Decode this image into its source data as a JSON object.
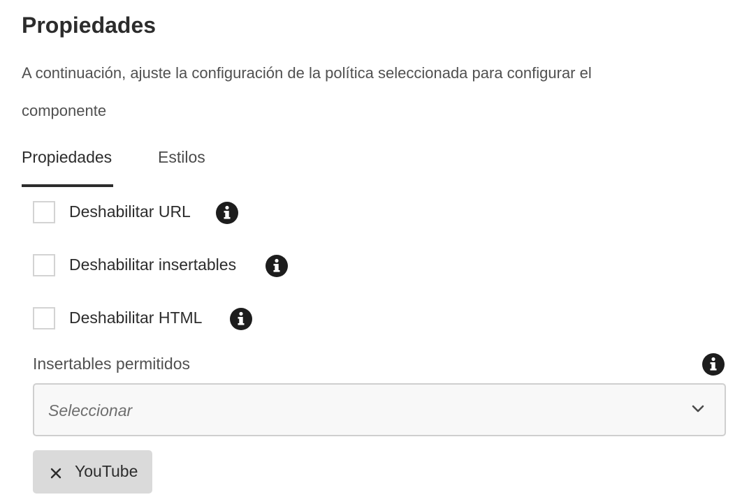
{
  "header": {
    "title": "Propiedades",
    "description": "A continuación, ajuste la configuración de la política seleccionada para configurar el componente"
  },
  "tabs": [
    {
      "label": "Propiedades",
      "active": true
    },
    {
      "label": "Estilos",
      "active": false
    }
  ],
  "options": [
    {
      "label": "Deshabilitar URL",
      "checked": false,
      "icon": "info-icon"
    },
    {
      "label": "Deshabilitar insertables",
      "checked": false,
      "icon": "info-icon"
    },
    {
      "label": "Deshabilitar HTML",
      "checked": false,
      "icon": "info-icon"
    }
  ],
  "allowed_embeds": {
    "label": "Insertables permitidos",
    "placeholder": "Seleccionar",
    "icon": "info-icon",
    "tags": [
      {
        "label": "YouTube",
        "remove_icon": "close-icon"
      }
    ]
  }
}
